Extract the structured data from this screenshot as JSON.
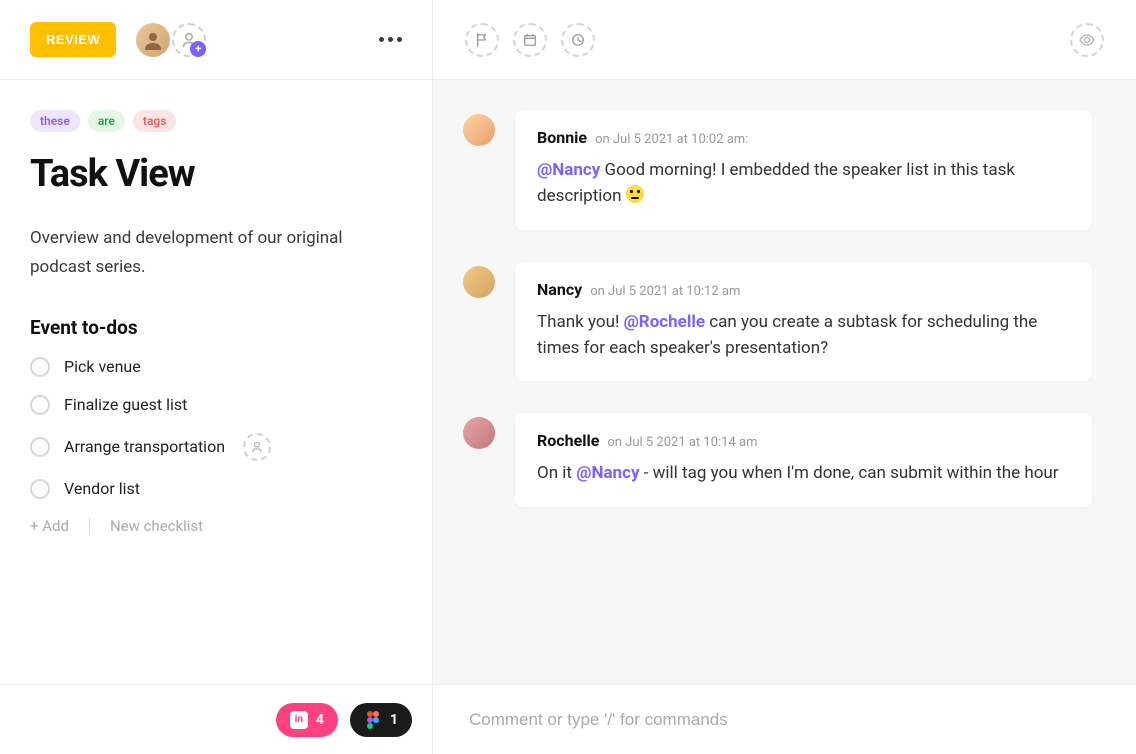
{
  "header": {
    "review_label": "REVIEW"
  },
  "tags": [
    "these",
    "are",
    "tags"
  ],
  "task": {
    "title": "Task View",
    "description": "Overview and development of our original podcast series."
  },
  "checklist": {
    "heading": "Event to-dos",
    "items": [
      {
        "label": "Pick venue",
        "assignable": false
      },
      {
        "label": "Finalize guest list",
        "assignable": false
      },
      {
        "label": "Arrange transportation",
        "assignable": true
      },
      {
        "label": "Vendor list",
        "assignable": false
      }
    ],
    "add_label": "+ Add",
    "new_checklist_label": "New checklist"
  },
  "footer_badges": {
    "invision_count": "4",
    "figma_count": "1"
  },
  "comments": [
    {
      "author": "Bonnie",
      "avatar_class": "bonnie",
      "time": "on Jul 5 2021 at 10:02 am:",
      "parts": [
        {
          "type": "mention",
          "text": "@Nancy"
        },
        {
          "type": "text",
          "text": " Good morning! I embedded the speaker list in this task description "
        },
        {
          "type": "emoji",
          "text": "🙂"
        }
      ]
    },
    {
      "author": "Nancy",
      "avatar_class": "nancy",
      "time": "on Jul 5 2021 at 10:12 am",
      "parts": [
        {
          "type": "text",
          "text": "Thank you! "
        },
        {
          "type": "mention",
          "text": "@Rochelle"
        },
        {
          "type": "text",
          "text": " can you create a subtask for scheduling the times for each speaker's presentation?"
        }
      ]
    },
    {
      "author": "Rochelle",
      "avatar_class": "rochelle",
      "time": "on Jul 5 2021 at 10:14 am",
      "parts": [
        {
          "type": "text",
          "text": "On it "
        },
        {
          "type": "mention",
          "text": "@Nancy"
        },
        {
          "type": "text",
          "text": " - will tag you when I'm done, can submit within the hour"
        }
      ]
    }
  ],
  "comment_input": {
    "placeholder": "Comment or type '/' for commands"
  }
}
